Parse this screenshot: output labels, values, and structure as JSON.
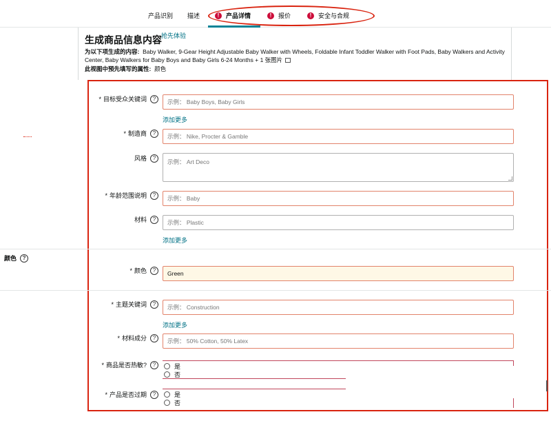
{
  "tabs": [
    {
      "label": "产品识别",
      "error": false,
      "active": false
    },
    {
      "label": "描述",
      "error": false,
      "active": false
    },
    {
      "label": "产品详情",
      "error": true,
      "active": true
    },
    {
      "label": "报价",
      "error": true,
      "active": false
    },
    {
      "label": "安全与合规",
      "error": true,
      "active": false
    }
  ],
  "info": {
    "title": "生成商品信息内容",
    "try_link": "抢先体验",
    "desc_label": "为以下项生成的内容:",
    "desc_text": "Baby Walker, 9-Gear Height Adjustable Baby Walker with Wheels, Foldable Infant Toddler Walker with Foot Pads, Baby Walkers and Activity Center, Baby Walkers for Baby Boys and Baby Girls 6-24 Months + 1 张图片",
    "attr_label": "此视图中预先填写的属性:",
    "attr_value": "颜色"
  },
  "form": {
    "target_keywords": {
      "label": "目标受众关键词",
      "placeholder": "示例： Baby Boys, Baby Girls"
    },
    "add_more_1": "添加更多",
    "manufacturer": {
      "label": "制造商",
      "placeholder": "示例： Nike, Procter & Gamble"
    },
    "style": {
      "label": "风格",
      "placeholder": "示例：  Art Deco"
    },
    "age_range": {
      "label": "年龄范围说明",
      "placeholder": "示例： Baby"
    },
    "material": {
      "label": "材料",
      "placeholder": "示例： Plastic"
    },
    "add_more_2": "添加更多",
    "color_section": "颜色",
    "color": {
      "label": "颜色",
      "value": "Green"
    },
    "theme_keywords": {
      "label": "主题关键词",
      "placeholder": "示例： Construction"
    },
    "add_more_3": "添加更多",
    "material_composition": {
      "label": "材料成分",
      "placeholder": "示例： 50% Cotton, 50% Latex"
    },
    "heat_sensitive": {
      "label": "商品是否热敏?",
      "yes": "是",
      "no": "否"
    },
    "expires": {
      "label": "产品是否过期",
      "yes": "是",
      "no": "否"
    }
  },
  "icons": {
    "help": "?",
    "error": "!"
  },
  "colors": {
    "accent": "#008296",
    "error": "#cc0c39",
    "annotation": "#d9230f",
    "link": "#007185",
    "filled_bg": "#fef8e6"
  }
}
